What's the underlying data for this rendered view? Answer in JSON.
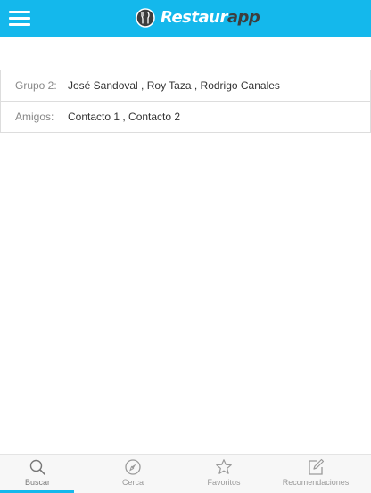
{
  "app": {
    "logo_text_first": "Restaur",
    "logo_text_second": "app",
    "brand_color": "#14b8ec"
  },
  "header": {
    "menu_icon": "hamburger-menu-icon"
  },
  "group_info": {
    "rows": [
      {
        "label": "Grupo 2:",
        "value": "José Sandoval , Roy Taza , Rodrigo Canales"
      },
      {
        "label": "Amigos:",
        "value": "Contacto 1 , Contacto 2"
      }
    ]
  },
  "tabbar": {
    "active_tab": "Buscar",
    "tabs": [
      {
        "label": "Buscar",
        "icon": "search-icon"
      },
      {
        "label": "Cerca",
        "icon": "compass-icon"
      },
      {
        "label": "Favoritos",
        "icon": "star-icon"
      },
      {
        "label": "Recomendaciones",
        "icon": "edit-icon"
      }
    ]
  }
}
